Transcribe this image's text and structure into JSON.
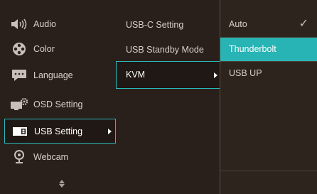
{
  "menu1": {
    "items": [
      {
        "label": "Audio",
        "icon": "speaker-icon"
      },
      {
        "label": "Color",
        "icon": "color-wheel-icon"
      },
      {
        "label": "Language",
        "icon": "speech-bubble-icon"
      },
      {
        "label": "OSD Setting",
        "icon": "monitor-gear-icon"
      },
      {
        "label": "USB Setting",
        "icon": "usb-setting-icon",
        "selected": true
      },
      {
        "label": "Webcam",
        "icon": "webcam-icon"
      }
    ]
  },
  "menu2": {
    "items": [
      {
        "label": "USB-C Setting"
      },
      {
        "label": "USB Standby Mode"
      },
      {
        "label": "KVM",
        "selected": true
      }
    ]
  },
  "menu3": {
    "items": [
      {
        "label": "Auto",
        "checked": true
      },
      {
        "label": "Thunderbolt",
        "highlighted": true
      },
      {
        "label": "USB UP"
      }
    ]
  },
  "colors": {
    "accent": "#2bb8b8",
    "panel": "#2a201b",
    "text": "#d8d0c8"
  }
}
